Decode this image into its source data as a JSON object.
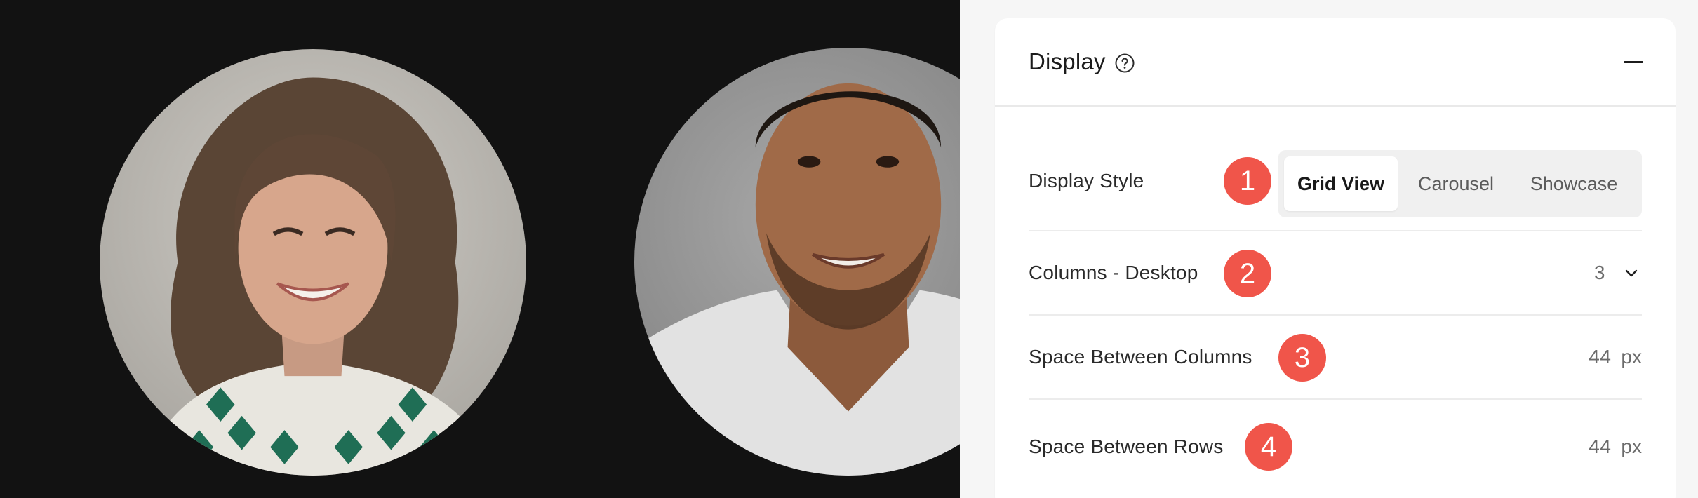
{
  "panel": {
    "title": "Display",
    "help_icon": "question-circle-icon",
    "collapse_icon": "minus-icon"
  },
  "settings": {
    "display_style": {
      "label": "Display Style",
      "badge": "1",
      "options": [
        "Grid View",
        "Carousel",
        "Showcase"
      ],
      "selected": "Grid View"
    },
    "columns_desktop": {
      "label": "Columns - Desktop",
      "badge": "2",
      "value": "3",
      "icon": "chevron-down-icon"
    },
    "space_between_columns": {
      "label": "Space Between Columns",
      "badge": "3",
      "value": "44",
      "unit": "px"
    },
    "space_between_rows": {
      "label": "Space Between Rows",
      "badge": "4",
      "value": "44",
      "unit": "px"
    }
  },
  "colors": {
    "accent_badge": "#f0554a",
    "preview_bg": "#121212",
    "panel_bg": "#ffffff"
  }
}
